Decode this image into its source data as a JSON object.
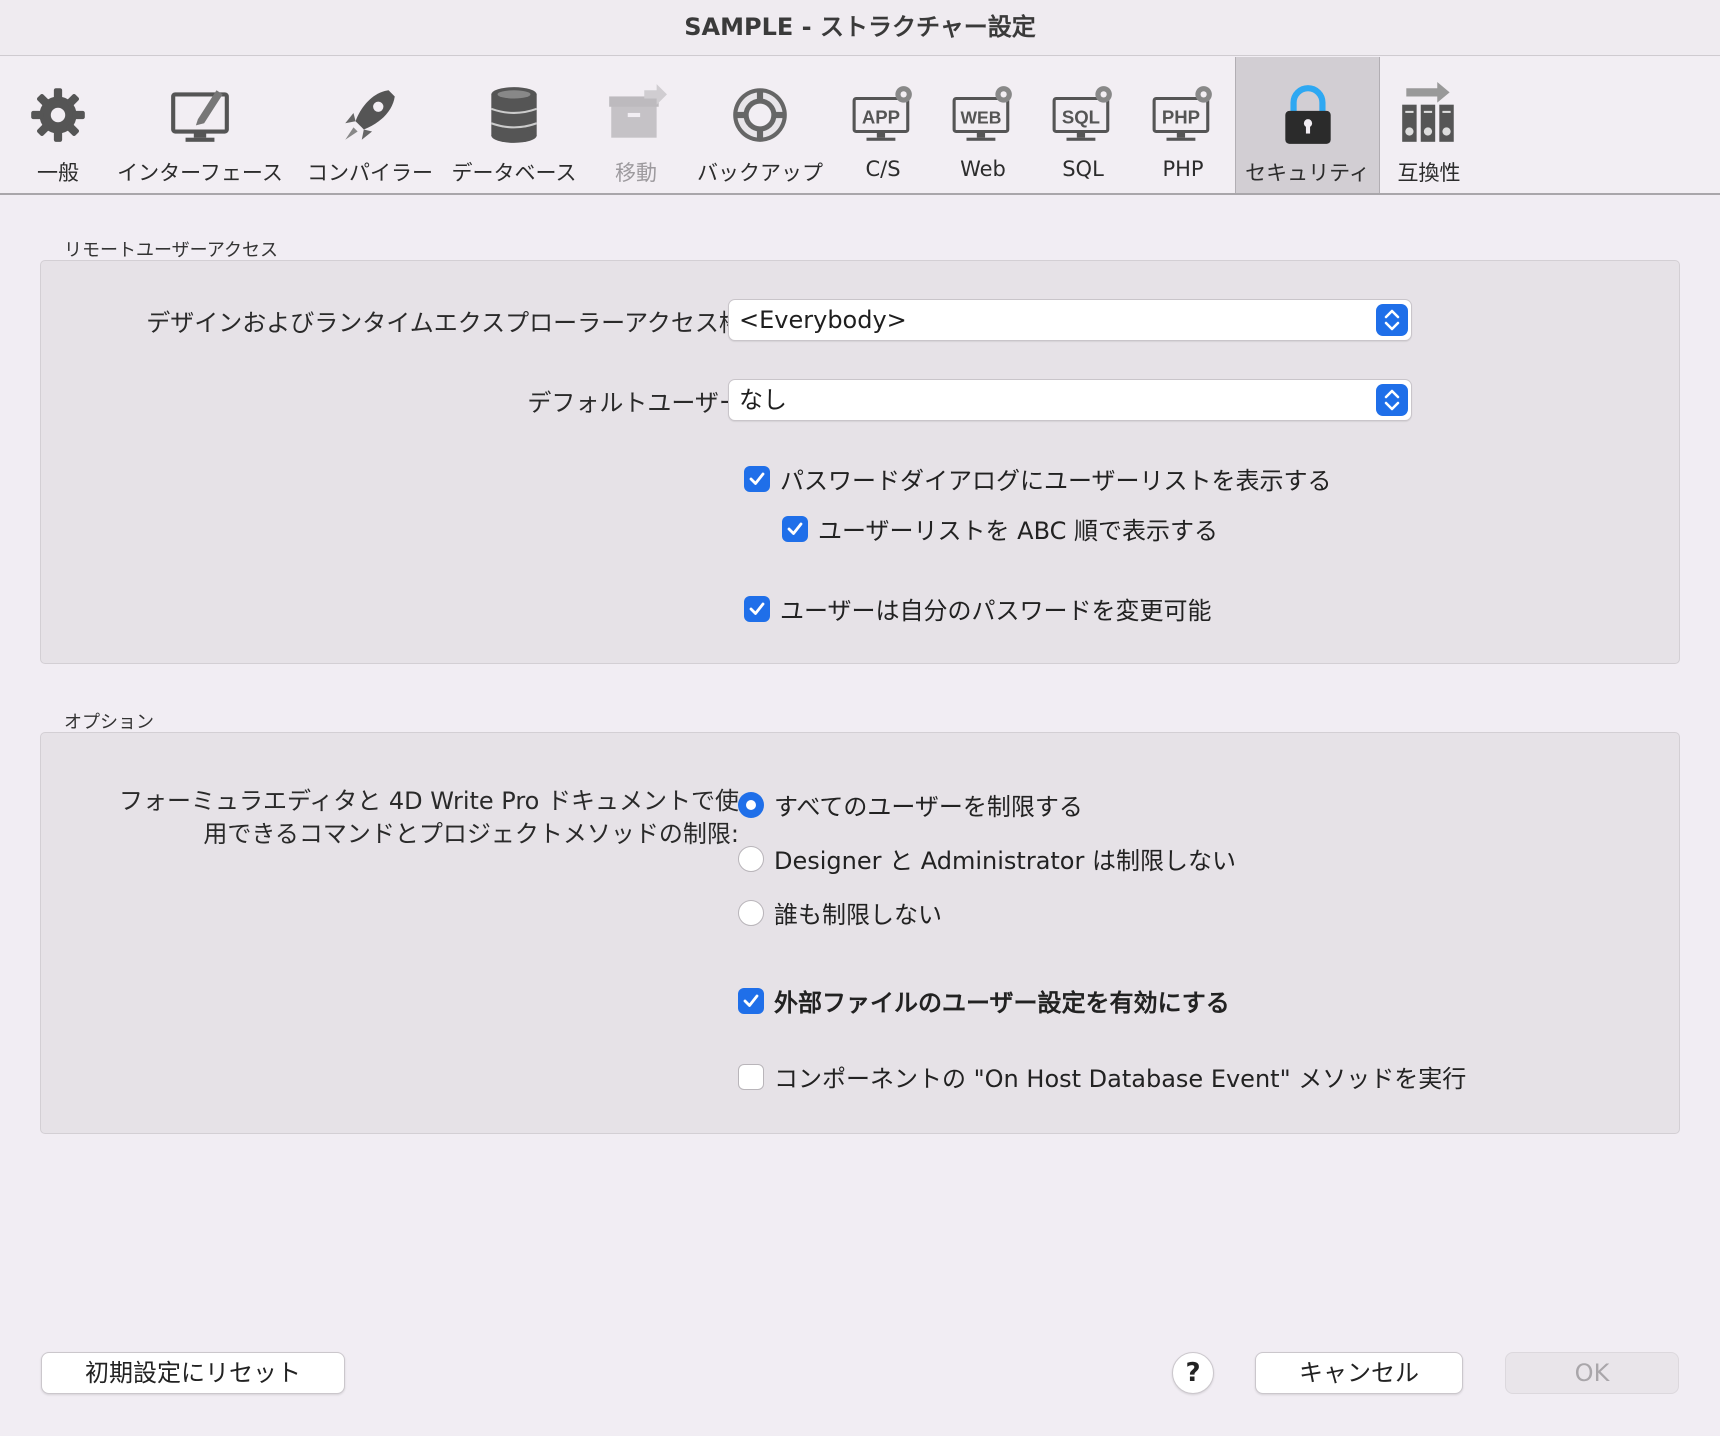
{
  "window": {
    "title": "SAMPLE - ストラクチャー設定"
  },
  "toolbar": {
    "items": [
      {
        "label": "一般",
        "icon": "gear-icon"
      },
      {
        "label": "インターフェース",
        "icon": "monitor-pencil-icon"
      },
      {
        "label": "コンパイラー",
        "icon": "rocket-icon"
      },
      {
        "label": "データベース",
        "icon": "database-icon"
      },
      {
        "label": "移動",
        "icon": "move-box-icon",
        "disabled": true
      },
      {
        "label": "バックアップ",
        "icon": "lifebuoy-icon"
      },
      {
        "label": "C/S",
        "icon": "app-server-icon"
      },
      {
        "label": "Web",
        "icon": "web-server-icon"
      },
      {
        "label": "SQL",
        "icon": "sql-server-icon"
      },
      {
        "label": "PHP",
        "icon": "php-server-icon"
      },
      {
        "label": "セキュリティ",
        "icon": "padlock-icon",
        "selected": true
      },
      {
        "label": "互換性",
        "icon": "compatibility-icon"
      }
    ]
  },
  "remote_access": {
    "title": "リモートユーザーアクセス",
    "design_access_label": "デザインおよびランタイムエクスプローラーアクセス権:",
    "design_access_value": "<Everybody>",
    "default_user_label": "デフォルトユーザー:",
    "default_user_value": "なし",
    "show_user_list": {
      "label": "パスワードダイアログにユーザーリストを表示する",
      "checked": true
    },
    "sort_user_list": {
      "label": "ユーザーリストを ABC 順で表示する",
      "checked": true
    },
    "users_change_password": {
      "label": "ユーザーは自分のパスワードを変更可能",
      "checked": true
    }
  },
  "options": {
    "title": "オプション",
    "restriction_label_line1": "フォーミュラエディタと 4D Write Pro ドキュメントで使",
    "restriction_label_line2": "用できるコマンドとプロジェクトメソッドの制限:",
    "radios": [
      {
        "label": "すべてのユーザーを制限する",
        "selected": true
      },
      {
        "label": "Designer と Administrator は制限しない",
        "selected": false
      },
      {
        "label": "誰も制限しない",
        "selected": false
      }
    ],
    "external_user_settings": {
      "label": "外部ファイルのユーザー設定を有効にする",
      "checked": true
    },
    "host_db_event": {
      "label": "コンポーネントの \"On Host Database Event\" メソッドを実行",
      "checked": false
    }
  },
  "footer": {
    "reset_label": "初期設定にリセット",
    "help_label": "?",
    "cancel_label": "キャンセル",
    "ok_label": "OK"
  },
  "colors": {
    "accent": "#1f6fe9",
    "group_bg": "#e6e2e7",
    "window_bg": "#f1edf3"
  }
}
